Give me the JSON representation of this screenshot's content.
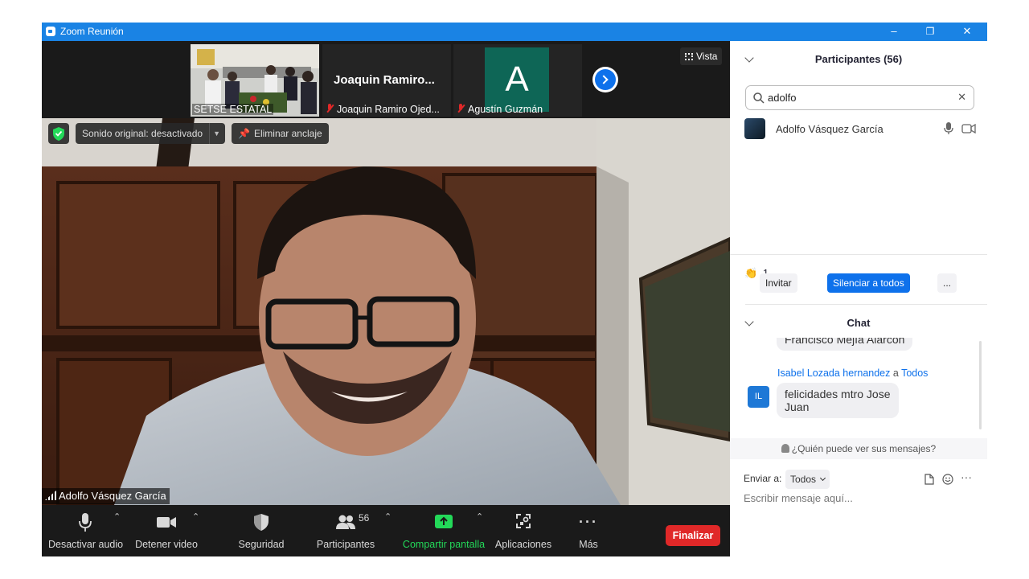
{
  "window": {
    "title": "Zoom Reunión",
    "minimize": "–",
    "restore": "❐",
    "close": "✕"
  },
  "thumbnails": [
    {
      "name": "SETSE ESTATAL",
      "muted": false
    },
    {
      "display": "Joaquin  Ramiro...",
      "name": "Joaquin Ramiro Ojed...",
      "muted": true
    },
    {
      "avatar_letter": "A",
      "name": "Agustín Guzmán",
      "muted": true,
      "color": "#0e6656"
    }
  ],
  "view_button": "Vista",
  "toolbar": {
    "original_sound": "Sonido original: desactivado",
    "unpin": "Eliminar anclaje"
  },
  "active_speaker": {
    "name": "Adolfo Vásquez García"
  },
  "bottom_bar": {
    "mute_audio": "Desactivar audio",
    "stop_video": "Detener video",
    "security": "Seguridad",
    "participants": "Participantes",
    "participants_count": "56",
    "share_screen": "Compartir pantalla",
    "apps": "Aplicaciones",
    "more": "Más",
    "end": "Finalizar"
  },
  "participants_panel": {
    "title": "Participantes (56)",
    "search_value": "adolfo",
    "results": [
      {
        "name": "Adolfo Vásquez García"
      }
    ],
    "reactions": {
      "emoji": "👏",
      "count": "1"
    },
    "invite": "Invitar",
    "mute_all": "Silenciar a todos",
    "more": "..."
  },
  "chat": {
    "title": "Chat",
    "prev_message_fragment": "Francisco Mejía Alarcón",
    "messages": [
      {
        "sender": "Isabel  Lozada hernandez",
        "to_word": "a",
        "recipient": "Todos",
        "initials": "IL",
        "text_line1": "felicidades mtro Jose",
        "text_line2": "Juan"
      }
    ],
    "who_can_see": "¿Quién puede ver sus mensajes?",
    "send_to_label": "Enviar a:",
    "send_to_value": "Todos",
    "placeholder": "Escribir mensaje aquí...",
    "more": "···"
  },
  "colors": {
    "zoom_blue": "#1a83e4",
    "end_red": "#e02828",
    "share_green": "#23d959",
    "button_blue": "#0e71eb"
  }
}
